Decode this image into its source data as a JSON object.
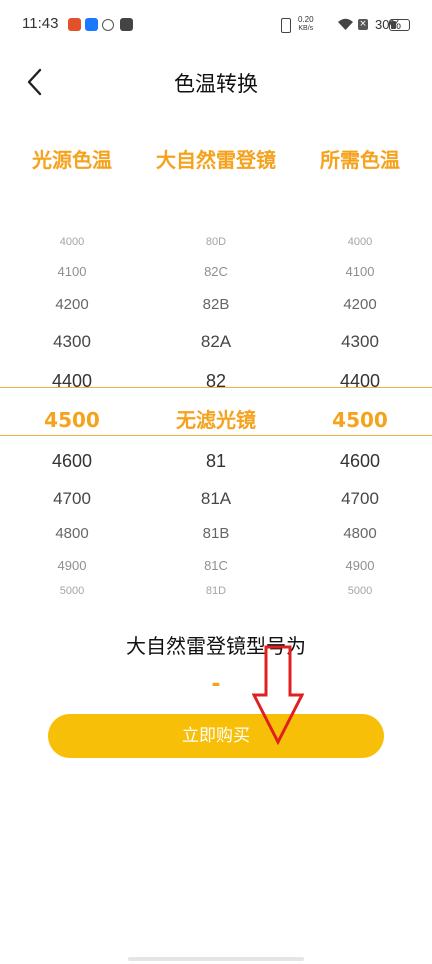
{
  "status_bar": {
    "time": "11:43",
    "net_speed_value": "0.20",
    "net_speed_unit": "KB/s",
    "battery": "30%",
    "battery_level": 0.3
  },
  "header": {
    "title": "色温转换"
  },
  "columns": {
    "left": "光源色温",
    "middle": "大自然雷登镜",
    "right": "所需色温"
  },
  "picker": {
    "left": [
      "4000",
      "4100",
      "4200",
      "4300",
      "4400",
      "4500",
      "4600",
      "4700",
      "4800",
      "4900",
      "5000"
    ],
    "middle": [
      "80D",
      "82C",
      "82B",
      "82A",
      "82",
      "无滤光镜",
      "81",
      "81A",
      "81B",
      "81C",
      "81D"
    ],
    "right": [
      "4000",
      "4100",
      "4200",
      "4300",
      "4400",
      "4500",
      "4600",
      "4700",
      "4800",
      "4900",
      "5000"
    ],
    "selected_index": 5
  },
  "result": {
    "label": "大自然雷登镜型号为",
    "value": "-"
  },
  "buy_button": {
    "label": "立即购买"
  },
  "colors": {
    "accent": "#f5a21d",
    "button": "#f7bf07",
    "annotation": "#e02020"
  }
}
